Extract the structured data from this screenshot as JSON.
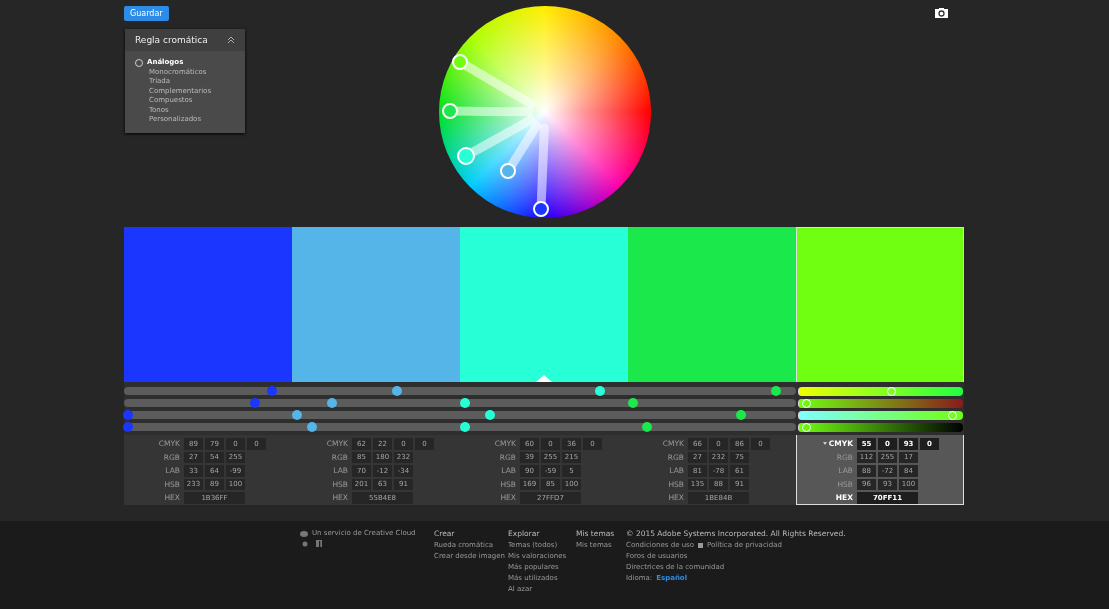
{
  "save_button": "Guardar",
  "rule_panel": {
    "title": "Regla cromática",
    "options": [
      {
        "label": "Análogos",
        "selected": true
      },
      {
        "label": "Monocromáticos",
        "selected": false
      },
      {
        "label": "Tríada",
        "selected": false
      },
      {
        "label": "Complementarios",
        "selected": false
      },
      {
        "label": "Compuestos",
        "selected": false
      },
      {
        "label": "Tonos",
        "selected": false
      },
      {
        "label": "Personalizados",
        "selected": false
      }
    ]
  },
  "swatches": [
    {
      "color": "#1b36ff",
      "selected": false,
      "base": false,
      "values": [
        {
          "label": "CMYK",
          "active": false,
          "cells": [
            "89",
            "79",
            "0",
            "0"
          ]
        },
        {
          "label": "RGB",
          "active": false,
          "cells": [
            "27",
            "54",
            "255"
          ]
        },
        {
          "label": "LAB",
          "active": false,
          "cells": [
            "33",
            "64",
            "-99"
          ]
        },
        {
          "label": "HSB",
          "active": false,
          "cells": [
            "233",
            "89",
            "100"
          ]
        }
      ],
      "hex_label": "HEX",
      "hex": "1B36FF"
    },
    {
      "color": "#55b4e8",
      "selected": false,
      "base": false,
      "values": [
        {
          "label": "CMYK",
          "active": false,
          "cells": [
            "62",
            "22",
            "0",
            "0"
          ]
        },
        {
          "label": "RGB",
          "active": false,
          "cells": [
            "85",
            "180",
            "232"
          ]
        },
        {
          "label": "LAB",
          "active": false,
          "cells": [
            "70",
            "-12",
            "-34"
          ]
        },
        {
          "label": "HSB",
          "active": false,
          "cells": [
            "201",
            "63",
            "91"
          ]
        }
      ],
      "hex_label": "HEX",
      "hex": "55B4E8"
    },
    {
      "color": "#27ffd7",
      "selected": false,
      "base": true,
      "values": [
        {
          "label": "CMYK",
          "active": false,
          "cells": [
            "60",
            "0",
            "36",
            "0"
          ]
        },
        {
          "label": "RGB",
          "active": false,
          "cells": [
            "39",
            "255",
            "215"
          ]
        },
        {
          "label": "LAB",
          "active": false,
          "cells": [
            "90",
            "-59",
            "5"
          ]
        },
        {
          "label": "HSB",
          "active": false,
          "cells": [
            "169",
            "85",
            "100"
          ]
        }
      ],
      "hex_label": "HEX",
      "hex": "27FFD7"
    },
    {
      "color": "#1be84b",
      "selected": false,
      "base": false,
      "values": [
        {
          "label": "CMYK",
          "active": false,
          "cells": [
            "66",
            "0",
            "86",
            "0"
          ]
        },
        {
          "label": "RGB",
          "active": false,
          "cells": [
            "27",
            "232",
            "75"
          ]
        },
        {
          "label": "LAB",
          "active": false,
          "cells": [
            "81",
            "-78",
            "61"
          ]
        },
        {
          "label": "HSB",
          "active": false,
          "cells": [
            "135",
            "88",
            "91"
          ]
        }
      ],
      "hex_label": "HEX",
      "hex": "1BE84B"
    },
    {
      "color": "#70ff11",
      "selected": true,
      "base": false,
      "values": [
        {
          "label": "CMYK",
          "active": true,
          "cells": [
            "55",
            "0",
            "93",
            "0"
          ]
        },
        {
          "label": "RGB",
          "active": false,
          "cells": [
            "112",
            "255",
            "17"
          ]
        },
        {
          "label": "LAB",
          "active": false,
          "cells": [
            "88",
            "-72",
            "84"
          ]
        },
        {
          "label": "HSB",
          "active": false,
          "cells": [
            "96",
            "93",
            "100"
          ]
        }
      ],
      "hex_label": "HEX",
      "hex": "70FF11"
    }
  ],
  "slider_rows": [
    {
      "dots": [
        {
          "color": "#1b36ff",
          "level": 0.22
        },
        {
          "color": "#55b4e8",
          "level": 0.406
        },
        {
          "color": "#27ffd7",
          "level": 0.708
        },
        {
          "color": "#1be84b",
          "level": 0.97
        }
      ]
    },
    {
      "dots": [
        {
          "color": "#1b36ff",
          "level": 0.195
        },
        {
          "color": "#55b4e8",
          "level": 0.31
        },
        {
          "color": "#27ffd7",
          "level": 0.507
        },
        {
          "color": "#1be84b",
          "level": 0.757
        }
      ]
    },
    {
      "dots": [
        {
          "color": "#1b36ff",
          "level": 0.006
        },
        {
          "color": "#55b4e8",
          "level": 0.257
        },
        {
          "color": "#27ffd7",
          "level": 0.545
        },
        {
          "color": "#1be84b",
          "level": 0.918
        }
      ]
    },
    {
      "dots": [
        {
          "color": "#1b36ff",
          "level": 0.006
        },
        {
          "color": "#55b4e8",
          "level": 0.28
        },
        {
          "color": "#27ffd7",
          "level": 0.507
        },
        {
          "color": "#1be84b",
          "level": 0.778
        }
      ]
    }
  ],
  "selected_sliders": [
    {
      "level": 0.56
    },
    {
      "level": 0.02
    },
    {
      "level": 0.94
    },
    {
      "level": 0.02
    }
  ],
  "footer": {
    "service": "Un servicio de Creative Cloud",
    "columns": [
      {
        "heading": "Crear",
        "links": [
          "Rueda cromática",
          "Crear desde imagen"
        ]
      },
      {
        "heading": "Explorar",
        "links": [
          "Temas (todos)",
          "Mis valoraciones",
          "Más populares",
          "Más utilizados",
          "Al azar"
        ]
      },
      {
        "heading": "Mis temas",
        "links": [
          "Mis temas"
        ]
      }
    ],
    "copyright": "© 2015 Adobe Systems Incorporated. All Rights Reserved.",
    "terms": "Condiciones de uso",
    "privacy": "Política de privacidad",
    "forums": "Foros de usuarios",
    "guidelines": "Directrices de la comunidad",
    "language_label": "Idioma:",
    "language": "Español"
  }
}
